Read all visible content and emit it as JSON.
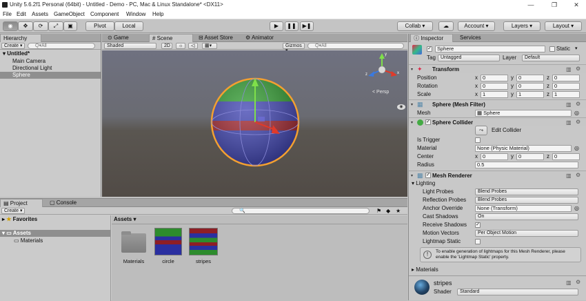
{
  "titlebar": {
    "title": "Unity 5.6.2f1 Personal (64bit) - Untitled - Demo - PC, Mac & Linux Standalone* <DX11>"
  },
  "menu": [
    "File",
    "Edit",
    "Assets",
    "GameObject",
    "Component",
    "Window",
    "Help"
  ],
  "toolbar": {
    "pivot": "Pivot",
    "local": "Local",
    "collab": "Collab ▾",
    "account": "Account",
    "layers": "Layers",
    "layout": "Layout"
  },
  "hierarchy": {
    "tab": "Hierarchy",
    "create": "Create",
    "search": "Q▾All",
    "scene": "Untitled*",
    "items": [
      "Main Camera",
      "Directional Light",
      "Sphere"
    ]
  },
  "scene": {
    "tabs": [
      "Game",
      "Scene",
      "Asset Store",
      "Animator"
    ],
    "shaded": "Shaded",
    "mode2d": "2D",
    "gizmos": "Gizmos",
    "search": "Q▾All",
    "persp": "< Persp"
  },
  "project": {
    "tabs": [
      "Project",
      "Console"
    ],
    "create": "Create",
    "favorites": "Favorites",
    "assets_root": "Assets",
    "subfolder": "Materials",
    "breadcrumb": "Assets",
    "items": [
      {
        "label": "Materials"
      },
      {
        "label": "circle"
      },
      {
        "label": "stripes"
      }
    ]
  },
  "inspector": {
    "tabs": [
      "Inspector",
      "Services"
    ],
    "object_name": "Sphere",
    "static_label": "Static",
    "tag_label": "Tag",
    "tag_value": "Untagged",
    "layer_label": "Layer",
    "layer_value": "Default",
    "transform": {
      "title": "Transform",
      "rows": [
        {
          "label": "Position",
          "x": "0",
          "y": "0",
          "z": "0"
        },
        {
          "label": "Rotation",
          "x": "0",
          "y": "0",
          "z": "0"
        },
        {
          "label": "Scale",
          "x": "1",
          "y": "1",
          "z": "1"
        }
      ]
    },
    "mesh_filter": {
      "title": "Sphere (Mesh Filter)",
      "mesh_label": "Mesh",
      "mesh_value": "Sphere"
    },
    "collider": {
      "title": "Sphere Collider",
      "edit": "Edit Collider",
      "trigger_label": "Is Trigger",
      "material_label": "Material",
      "material_value": "None (Physic Material)",
      "center_label": "Center",
      "cx": "0",
      "cy": "0",
      "cz": "0",
      "radius_label": "Radius",
      "radius_value": "0.5"
    },
    "renderer": {
      "title": "Mesh Renderer",
      "lighting": "Lighting",
      "rows": [
        {
          "label": "Light Probes",
          "value": "Blend Probes"
        },
        {
          "label": "Reflection Probes",
          "value": "Blend Probes"
        },
        {
          "label": "Anchor Override",
          "value": "None (Transform)"
        },
        {
          "label": "Cast Shadows",
          "value": "On"
        },
        {
          "label": "Receive Shadows",
          "value": "✓"
        },
        {
          "label": "Motion Vectors",
          "value": "Per Object Motion"
        },
        {
          "label": "Lightmap Static",
          "value": ""
        }
      ],
      "info": "To enable generation of lightmaps for this Mesh Renderer, please enable the 'Lightmap Static' property.",
      "materials": "Materials"
    },
    "material": {
      "name": "stripes",
      "shader_label": "Shader",
      "shader_value": "Standard"
    }
  },
  "axis": {
    "x": "x",
    "y": "y",
    "z": "z"
  }
}
